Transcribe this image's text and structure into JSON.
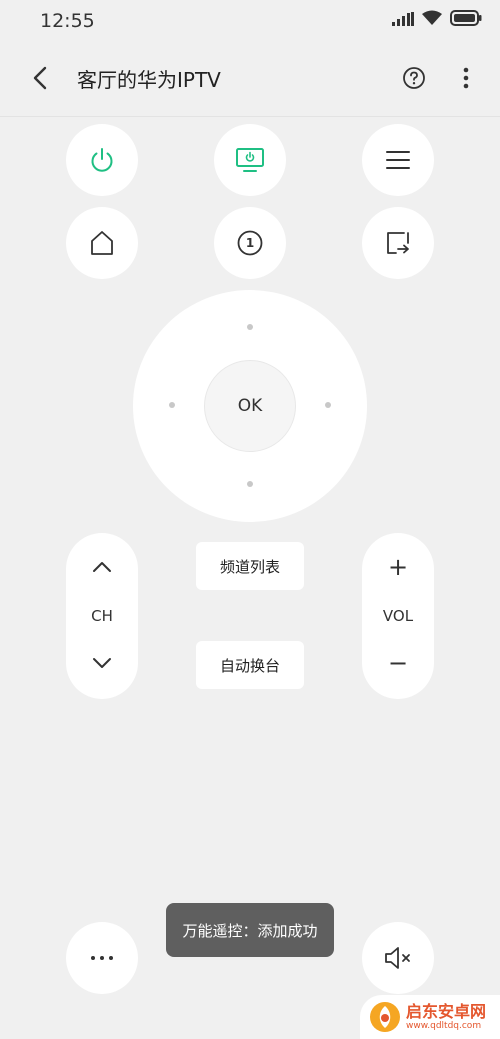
{
  "status_bar": {
    "time": "12:55"
  },
  "header": {
    "title": "客厅的华为IPTV"
  },
  "buttons": {
    "power": "power-icon",
    "input": "input-source-icon",
    "menu": "menu-icon",
    "home": "home-icon",
    "one": "1",
    "back": "return-icon"
  },
  "dpad": {
    "ok_label": "OK"
  },
  "channel": {
    "label": "CH"
  },
  "volume": {
    "label": "VOL",
    "plus": "+",
    "minus": "−"
  },
  "actions": {
    "channel_list": "频道列表",
    "auto_switch": "自动换台"
  },
  "toast": "万能遥控：添加成功",
  "watermark": {
    "name": "启东安卓网",
    "url": "www.qdltdq.com"
  },
  "colors": {
    "accent": "#1fbf83",
    "background": "#f0f0f0",
    "button": "#ffffff"
  }
}
